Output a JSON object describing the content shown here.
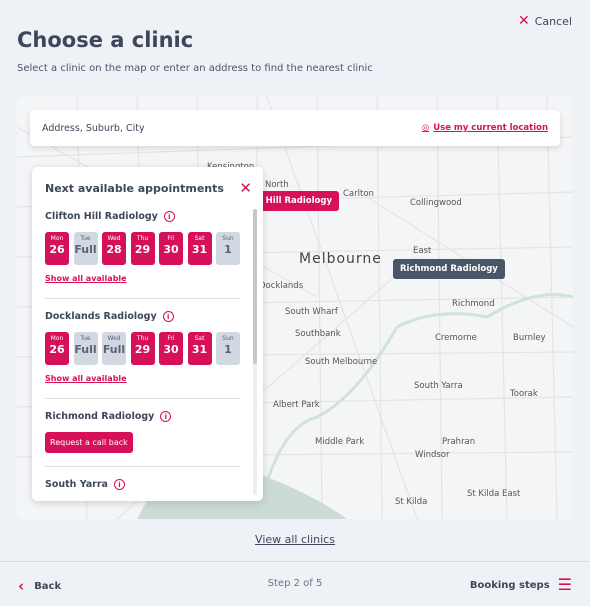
{
  "header": {
    "cancel": "Cancel",
    "title": "Choose a clinic",
    "subtitle": "Select a clinic on the map or enter an address to find the nearest clinic"
  },
  "search": {
    "placeholder": "Address, Suburb, City",
    "value": "",
    "use_location": "Use my current location"
  },
  "map": {
    "labels": [
      "Kensington",
      "North",
      "Carlton",
      "Collingwood",
      "Melbourne",
      "East",
      "Docklands",
      "South Wharf",
      "Southbank",
      "South Melbourne",
      "Richmond",
      "Cremorne",
      "Burnley",
      "South Yarra",
      "Toorak",
      "Albert Park",
      "Middle Park",
      "Prahran",
      "Windsor",
      "St Kilda",
      "St Kilda East"
    ],
    "pins": [
      {
        "label": "Clifton Hill Radiology",
        "color": "#d6115a"
      },
      {
        "label": "Richmond Radiology",
        "color": "#4a5568"
      }
    ]
  },
  "panel": {
    "title": "Next available appointments",
    "clinics": [
      {
        "name": "Clifton Hill Radiology",
        "days": [
          {
            "d": "Mon",
            "n": "26",
            "a": true
          },
          {
            "d": "Tue",
            "n": "Full",
            "a": false
          },
          {
            "d": "Wed",
            "n": "28",
            "a": true
          },
          {
            "d": "Thu",
            "n": "29",
            "a": true
          },
          {
            "d": "Fri",
            "n": "30",
            "a": true
          },
          {
            "d": "Sat",
            "n": "31",
            "a": true
          },
          {
            "d": "Sun",
            "n": "1",
            "a": false
          }
        ],
        "link": "Show all available"
      },
      {
        "name": "Docklands Radiology",
        "days": [
          {
            "d": "Mon",
            "n": "26",
            "a": true
          },
          {
            "d": "Tue",
            "n": "Full",
            "a": false
          },
          {
            "d": "Wed",
            "n": "Full",
            "a": false
          },
          {
            "d": "Thu",
            "n": "29",
            "a": true
          },
          {
            "d": "Fri",
            "n": "30",
            "a": true
          },
          {
            "d": "Sat",
            "n": "31",
            "a": true
          },
          {
            "d": "Sun",
            "n": "1",
            "a": false
          }
        ],
        "link": "Show all available"
      },
      {
        "name": "Richmond Radiology",
        "button": "Request a call back"
      },
      {
        "name": "South Yarra"
      }
    ]
  },
  "footer": {
    "view_all": "View all clinics",
    "back": "Back",
    "step": "Step 2 of 5",
    "booking_steps": "Booking steps"
  },
  "colors": {
    "accent": "#d6115a",
    "text": "#3d4759",
    "background": "#eef2f7"
  }
}
